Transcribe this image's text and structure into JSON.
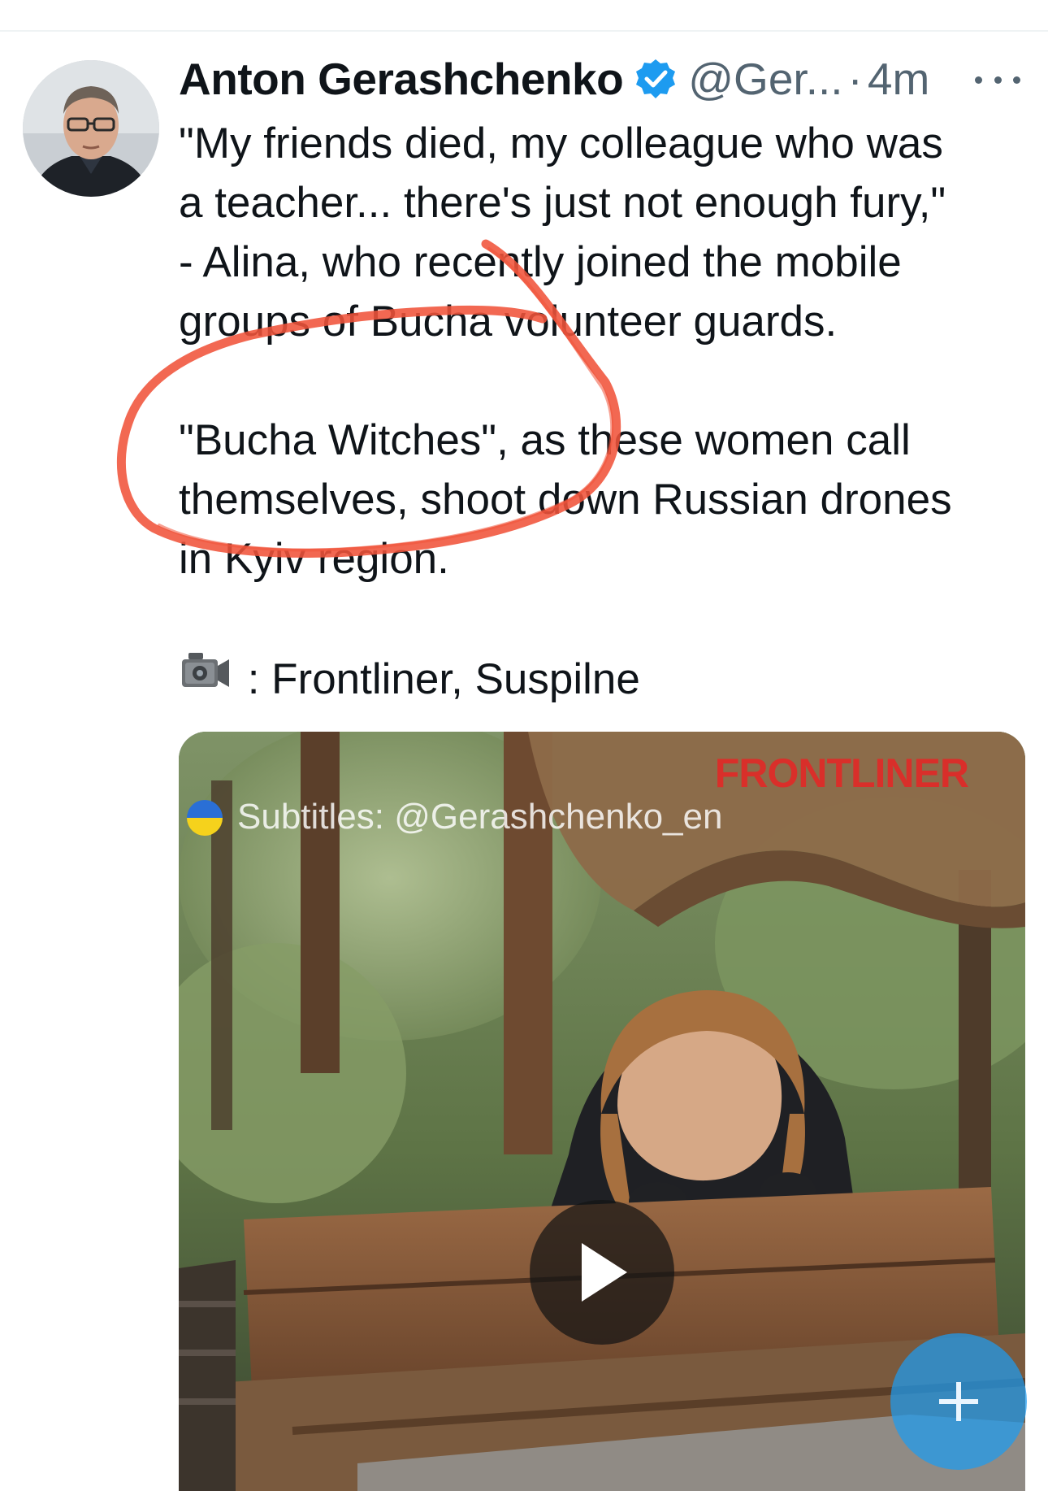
{
  "tweet": {
    "author_name": "Anton Gerashchenko",
    "handle": "@Ger...",
    "separator": "·",
    "timestamp": "4m",
    "verified": true,
    "text_lines": [
      "\"My friends died, my colleague who was",
      "a teacher... there's just not enough fury,\"",
      "- Alina, who recently joined the mobile",
      "groups of Bucha volunteer guards.",
      "",
      "\"Bucha Witches\", as these women call",
      "themselves, shoot down Russian drones",
      "in Kyiv region.",
      ""
    ],
    "credit_text": ": Frontliner, Suspilne"
  },
  "media": {
    "type": "video",
    "watermark": "FRONTLINER",
    "subtitle_credit": "Subtitles: @Gerashchenko_en"
  },
  "icons": {
    "verified": "verified-badge-icon",
    "more": "more-icon",
    "camera": "video-camera-icon",
    "play": "play-icon",
    "compose": "plus-icon",
    "flag": "ukraine-flag-icon"
  },
  "colors": {
    "accent": "#1d9bf0",
    "annotation": "#f0533a",
    "secondary_text": "#536471",
    "watermark": "#e02a28"
  }
}
